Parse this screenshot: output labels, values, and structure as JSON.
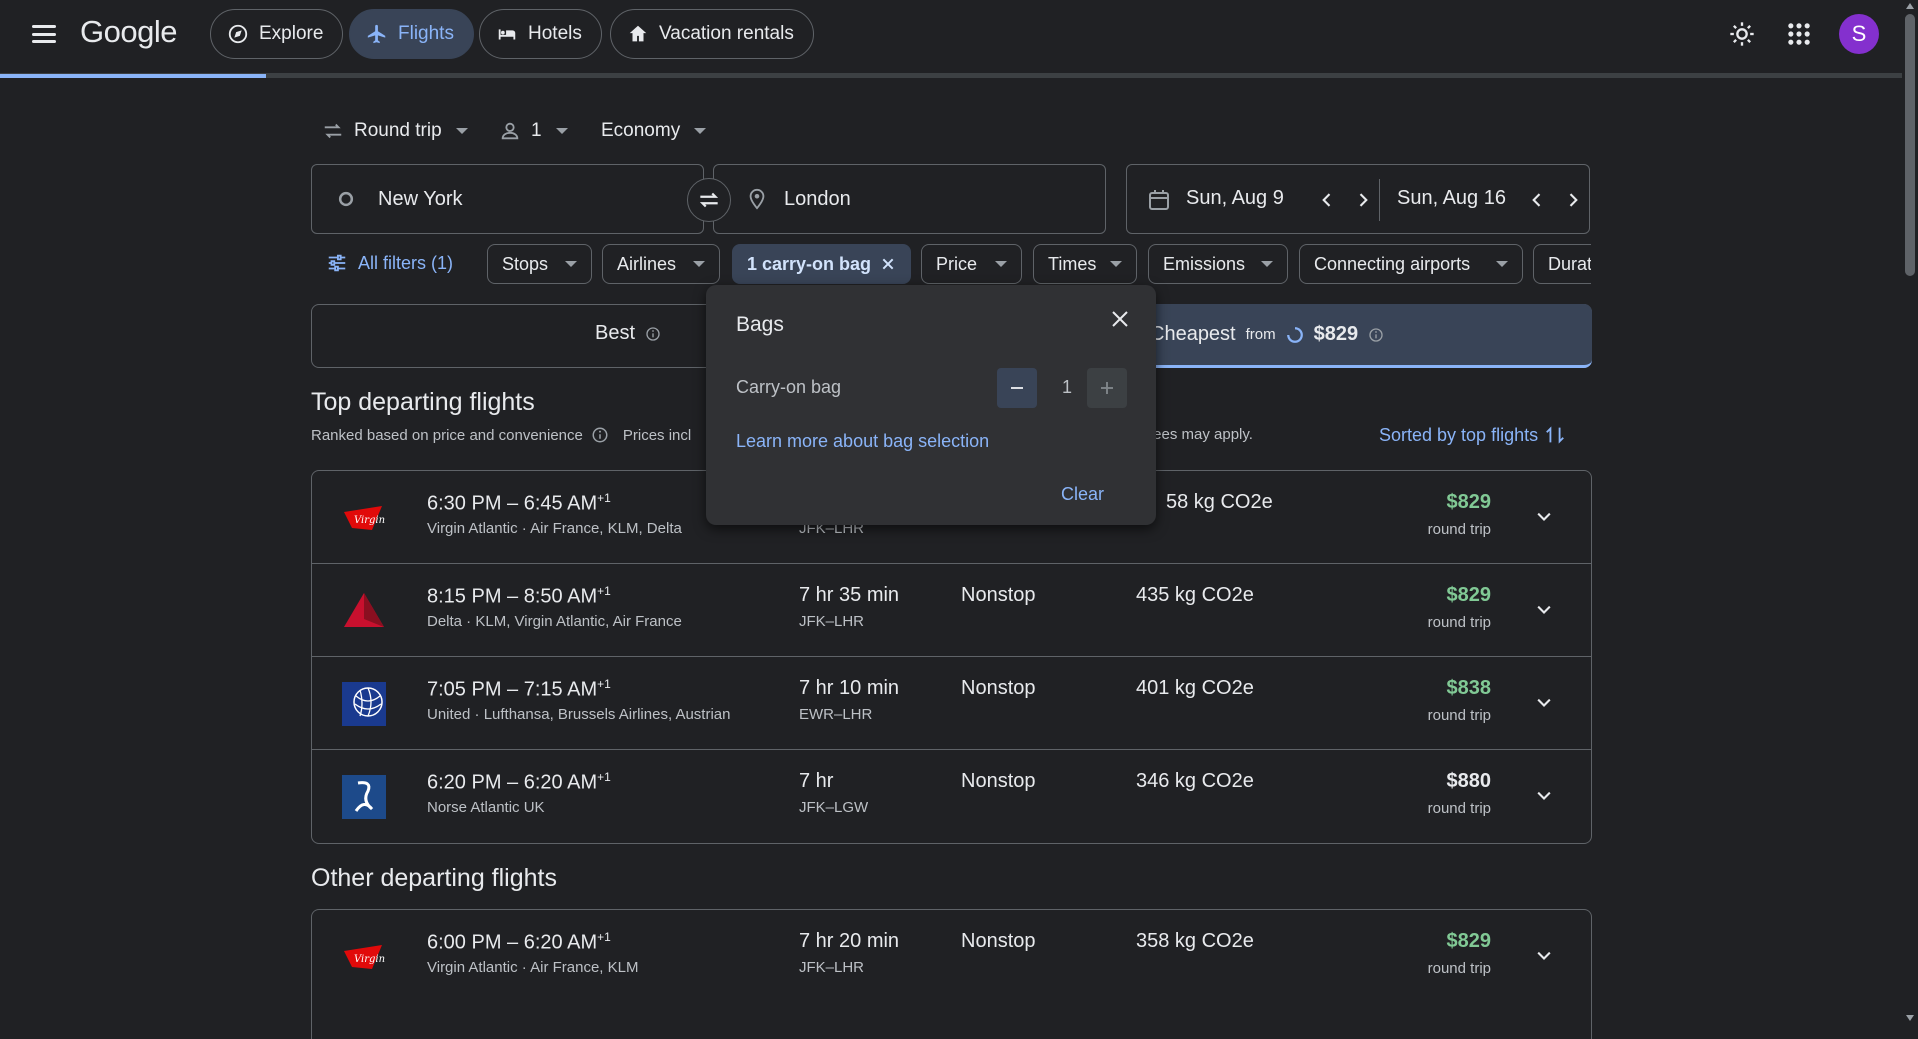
{
  "header": {
    "logo": "Google",
    "nav": [
      {
        "label": "Explore",
        "icon": "explore-icon"
      },
      {
        "label": "Flights",
        "icon": "flight-icon",
        "active": true
      },
      {
        "label": "Hotels",
        "icon": "hotel-icon"
      },
      {
        "label": "Vacation rentals",
        "icon": "home-icon"
      }
    ],
    "avatar_letter": "S",
    "progress": 0.14
  },
  "search": {
    "trip_type": "Round trip",
    "passengers": "1",
    "cabin": "Economy",
    "origin": "New York",
    "destination": "London",
    "depart_date": "Sun, Aug 9",
    "return_date": "Sun, Aug 16"
  },
  "filters": {
    "all_filters": "All filters (1)",
    "chips": [
      "Stops",
      "Airlines",
      "1 carry-on bag",
      "Price",
      "Times",
      "Emissions",
      "Connecting airports",
      "Durat"
    ]
  },
  "tabs": {
    "best": "Best",
    "cheapest": "Cheapest",
    "cheapest_from": "from",
    "cheapest_price": "$829"
  },
  "top": {
    "title": "Top departing flights",
    "ranked": "Ranked based on price and convenience",
    "prices_note": "Prices incl",
    "fees_note": "fees may apply.",
    "sort": "Sorted by top flights"
  },
  "flights": [
    {
      "times": "6:30 PM – 6:45 AM",
      "plus": "+1",
      "airline": "Virgin Atlantic · Air France, KLM, Delta",
      "duration": "",
      "route": "JFK–LHR",
      "stops": "",
      "emissions": "58 kg CO2e",
      "price": "$829",
      "price_type": "round trip",
      "logo": "virgin"
    },
    {
      "times": "8:15 PM – 8:50 AM",
      "plus": "+1",
      "airline": "Delta · KLM, Virgin Atlantic, Air France",
      "duration": "7 hr 35 min",
      "route": "JFK–LHR",
      "stops": "Nonstop",
      "emissions": "435 kg CO2e",
      "price": "$829",
      "price_type": "round trip",
      "logo": "delta"
    },
    {
      "times": "7:05 PM – 7:15 AM",
      "plus": "+1",
      "airline": "United · Lufthansa, Brussels Airlines, Austrian",
      "duration": "7 hr 10 min",
      "route": "EWR–LHR",
      "stops": "Nonstop",
      "emissions": "401 kg CO2e",
      "price": "$838",
      "price_type": "round trip",
      "logo": "united"
    },
    {
      "times": "6:20 PM – 6:20 AM",
      "plus": "+1",
      "airline": "Norse Atlantic UK",
      "duration": "7 hr",
      "route": "JFK–LGW",
      "stops": "Nonstop",
      "emissions": "346 kg CO2e",
      "price": "$880",
      "price_type": "round trip",
      "logo": "norse"
    }
  ],
  "other": {
    "title": "Other departing flights",
    "flights": [
      {
        "times": "6:00 PM – 6:20 AM",
        "plus": "+1",
        "airline": "Virgin Atlantic · Air France, KLM",
        "duration": "7 hr 20 min",
        "route": "JFK–LHR",
        "stops": "Nonstop",
        "emissions": "358 kg CO2e",
        "price": "$829",
        "price_type": "round trip",
        "logo": "virgin"
      }
    ]
  },
  "bags_popup": {
    "title": "Bags",
    "label": "Carry-on bag",
    "count": "1",
    "learn_more": "Learn more about bag selection",
    "clear": "Clear"
  },
  "colors": {
    "accent": "#8ab4f8",
    "price_green": "#81c995",
    "avatar": "#8430ce"
  }
}
